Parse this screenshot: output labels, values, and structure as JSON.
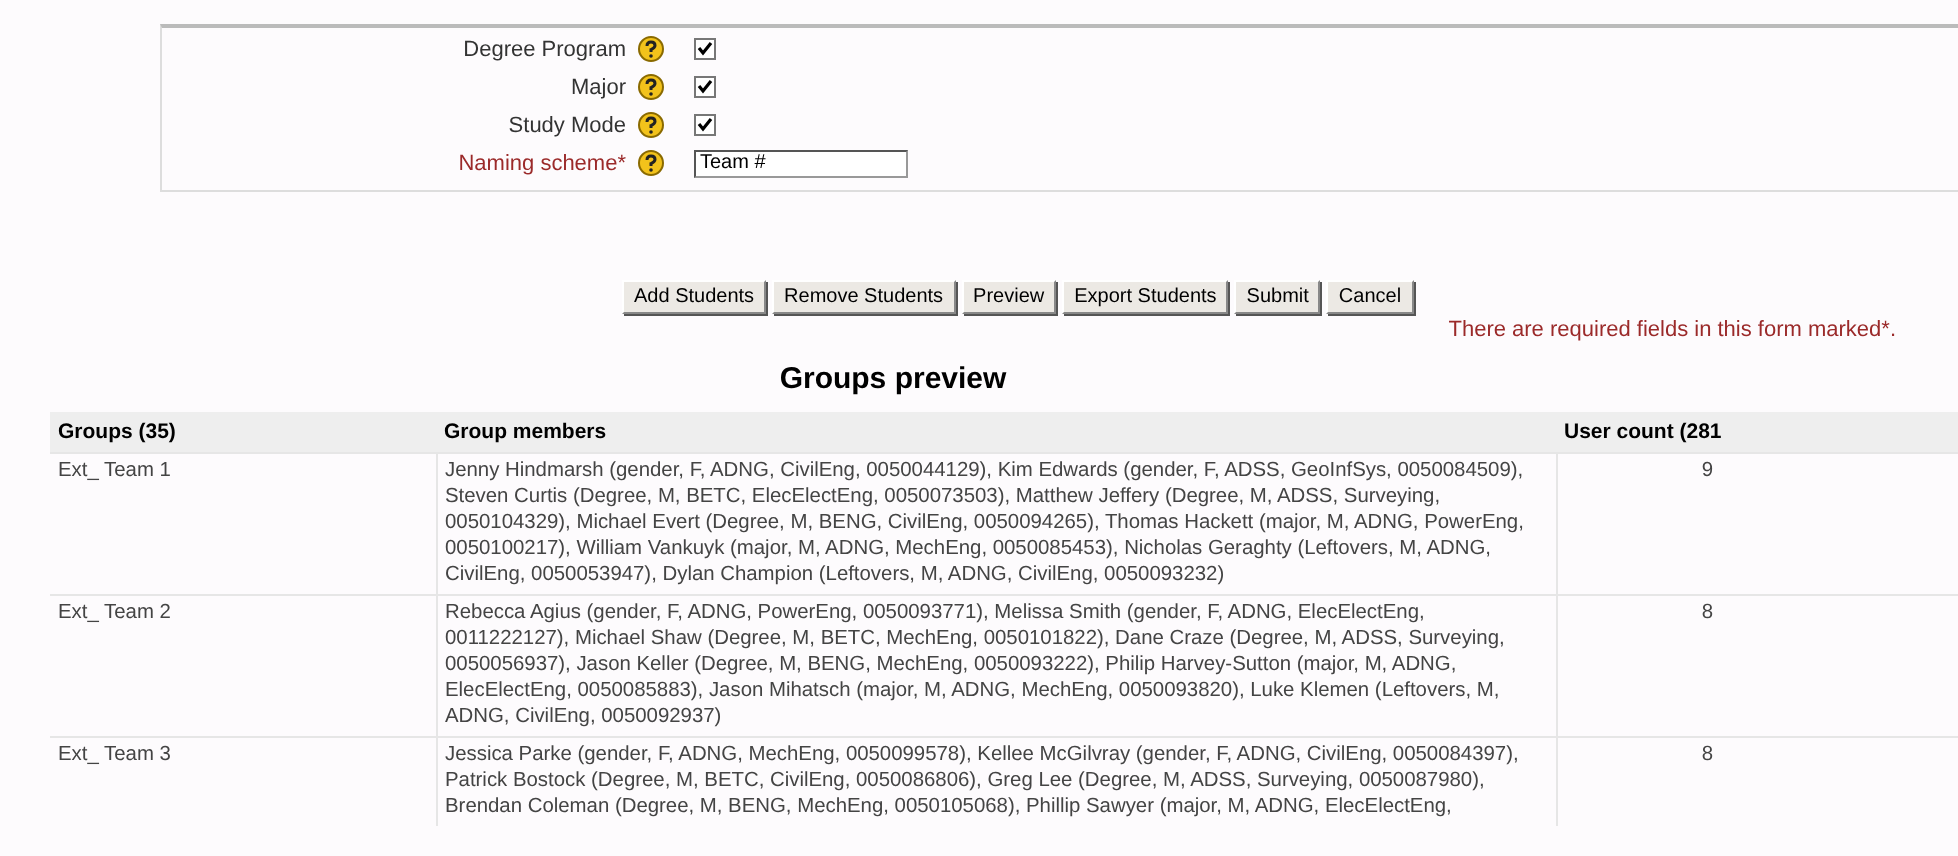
{
  "form": {
    "fields": [
      {
        "label": "Degree Program",
        "kind": "checkbox",
        "required": false,
        "checked": true
      },
      {
        "label": "Major",
        "kind": "checkbox",
        "required": false,
        "checked": true
      },
      {
        "label": "Study Mode",
        "kind": "checkbox",
        "required": false,
        "checked": true
      },
      {
        "label": "Naming scheme*",
        "kind": "text",
        "required": true,
        "value": "Team #"
      }
    ],
    "buttons": [
      "Add Students",
      "Remove Students",
      "Preview",
      "Export Students",
      "Submit",
      "Cancel"
    ],
    "required_note": "There are required fields in this form marked*."
  },
  "preview": {
    "title": "Groups preview",
    "columns": [
      "Groups (35)",
      "Group members",
      "User count (281"
    ],
    "rows": [
      {
        "group": "Ext_ Team 1",
        "members": "Jenny Hindmarsh (gender, F, ADNG, CivilEng, 0050044129), Kim Edwards (gender, F, ADSS, GeoInfSys, 0050084509), Steven Curtis (Degree, M, BETC, ElecElectEng, 0050073503), Matthew Jeffery (Degree, M, ADSS, Surveying, 0050104329), Michael Evert (Degree, M, BENG, CivilEng, 0050094265), Thomas Hackett (major, M, ADNG, PowerEng, 0050100217), William Vankuyk (major, M, ADNG, MechEng, 0050085453), Nicholas Geraghty (Leftovers, M, ADNG, CivilEng, 0050053947), Dylan Champion (Leftovers, M, ADNG, CivilEng, 0050093232)",
        "count": "9"
      },
      {
        "group": "Ext_ Team 2",
        "members": "Rebecca Agius (gender, F, ADNG, PowerEng, 0050093771), Melissa Smith (gender, F, ADNG, ElecElectEng, 0011222127), Michael Shaw (Degree, M, BETC, MechEng, 0050101822), Dane Craze (Degree, M, ADSS, Surveying, 0050056937), Jason Keller (Degree, M, BENG, MechEng, 0050093222), Philip Harvey-Sutton (major, M, ADNG, ElecElectEng, 0050085883), Jason Mihatsch (major, M, ADNG, MechEng, 0050093820), Luke Klemen (Leftovers, M, ADNG, CivilEng, 0050092937)",
        "count": "8"
      },
      {
        "group": "Ext_ Team 3",
        "members": "Jessica Parke (gender, F, ADNG, MechEng, 0050099578), Kellee McGilvray (gender, F, ADNG, CivilEng, 0050084397), Patrick Bostock (Degree, M, BETC, CivilEng, 0050086806), Greg Lee (Degree, M, ADSS, Surveying, 0050087980), Brendan Coleman (Degree, M, BENG, MechEng, 0050105068), Phillip Sawyer (major, M, ADNG, ElecElectEng,",
        "count": "8"
      }
    ]
  }
}
